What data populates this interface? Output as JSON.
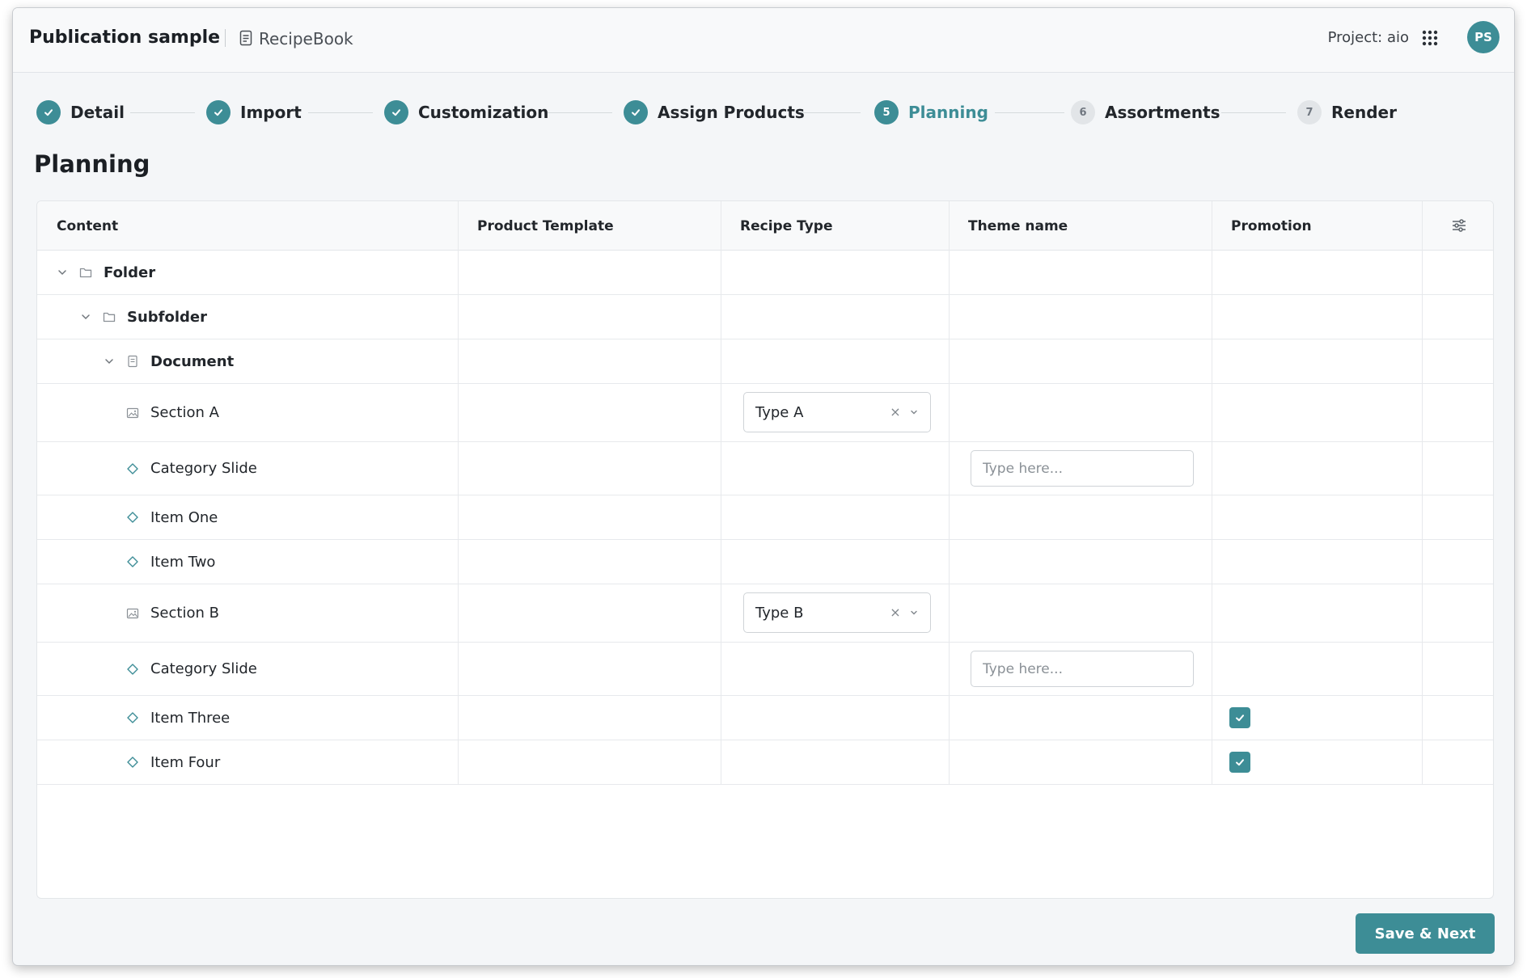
{
  "header": {
    "app_title": "Publication sample",
    "document_name": "RecipeBook",
    "project_label": "Project: aio",
    "avatar_initials": "PS",
    "apps_icon": "grid-apps-icon"
  },
  "stepper": {
    "steps": [
      {
        "number": "1",
        "label": "Detail",
        "status": "done"
      },
      {
        "number": "2",
        "label": "Import",
        "status": "done"
      },
      {
        "number": "3",
        "label": "Customization",
        "status": "done"
      },
      {
        "number": "4",
        "label": "Assign Products",
        "status": "done"
      },
      {
        "number": "5",
        "label": "Planning",
        "status": "active"
      },
      {
        "number": "6",
        "label": "Assortments",
        "status": "pending"
      },
      {
        "number": "7",
        "label": "Render",
        "status": "pending"
      }
    ]
  },
  "page": {
    "title": "Planning"
  },
  "table": {
    "columns": [
      "Content",
      "Product Template",
      "Recipe Type",
      "Theme name",
      "Promotion"
    ],
    "rows": [
      {
        "label": "Folder",
        "type": "folder",
        "icon": "folder-icon"
      },
      {
        "label": "Subfolder",
        "type": "folder",
        "icon": "folder-icon"
      },
      {
        "label": "Document",
        "type": "document",
        "icon": "document-icon"
      },
      {
        "label": "Section A",
        "type": "section",
        "icon": "image-icon",
        "recipe_type": "Type A"
      },
      {
        "label": "Category Slide",
        "type": "item",
        "icon": "diamond-icon",
        "theme_placeholder": "Type here..."
      },
      {
        "label": "Item One",
        "type": "item",
        "icon": "diamond-icon"
      },
      {
        "label": "Item Two",
        "type": "item",
        "icon": "diamond-icon"
      },
      {
        "label": "Section B",
        "type": "section",
        "icon": "image-icon",
        "recipe_type": "Type B"
      },
      {
        "label": "Category Slide",
        "type": "item",
        "icon": "diamond-icon",
        "theme_placeholder": "Type here..."
      },
      {
        "label": "Item Three",
        "type": "item",
        "icon": "diamond-icon",
        "promotion": true
      },
      {
        "label": "Item Four",
        "type": "item",
        "icon": "diamond-icon",
        "promotion": true
      }
    ]
  },
  "actions": {
    "save_next_label": "Save & Next"
  },
  "colors": {
    "accent": "#3d8d96",
    "background": "#f4f6f8",
    "border": "#e3e6e9"
  }
}
